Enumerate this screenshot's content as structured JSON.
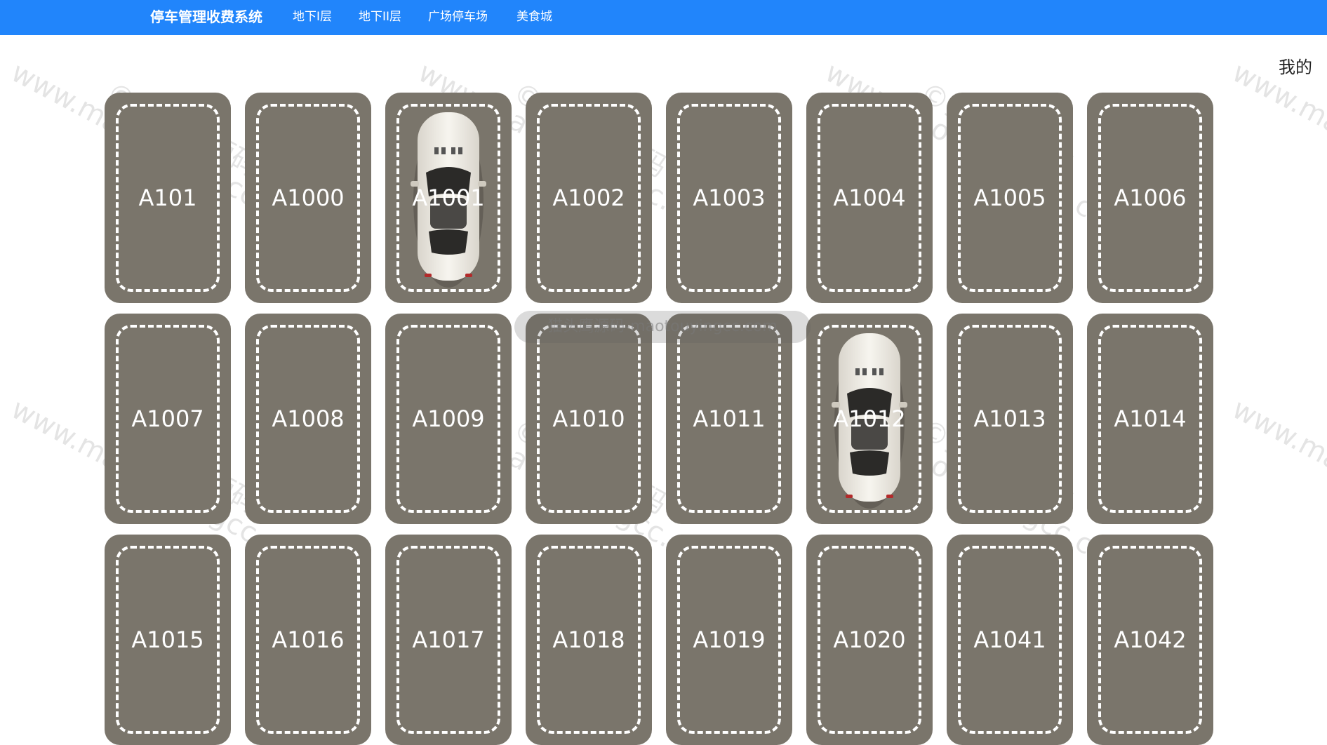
{
  "colors": {
    "nav_bg": "#2185fb",
    "slot_bg": "#7a756b",
    "lines": "#ffffff"
  },
  "nav": {
    "brand": "停车管理收费系统",
    "items": [
      {
        "label": "地下I层"
      },
      {
        "label": "地下II层"
      },
      {
        "label": "广场停车场"
      },
      {
        "label": "美食城"
      }
    ],
    "me": "我的"
  },
  "toast": "猫头鹰源码-maotouyingcc.com",
  "watermark": {
    "url": "www.maotouyingcc.com",
    "cn": "©猫头鹰源码"
  },
  "parking": {
    "slots": [
      {
        "id": "A101",
        "occupied": false
      },
      {
        "id": "A1000",
        "occupied": false
      },
      {
        "id": "A1001",
        "occupied": true
      },
      {
        "id": "A1002",
        "occupied": false
      },
      {
        "id": "A1003",
        "occupied": false
      },
      {
        "id": "A1004",
        "occupied": false
      },
      {
        "id": "A1005",
        "occupied": false
      },
      {
        "id": "A1006",
        "occupied": false
      },
      {
        "id": "A1007",
        "occupied": false
      },
      {
        "id": "A1008",
        "occupied": false
      },
      {
        "id": "A1009",
        "occupied": false
      },
      {
        "id": "A1010",
        "occupied": false
      },
      {
        "id": "A1011",
        "occupied": false
      },
      {
        "id": "A1012",
        "occupied": true
      },
      {
        "id": "A1013",
        "occupied": false
      },
      {
        "id": "A1014",
        "occupied": false
      },
      {
        "id": "A1015",
        "occupied": false
      },
      {
        "id": "A1016",
        "occupied": false
      },
      {
        "id": "A1017",
        "occupied": false
      },
      {
        "id": "A1018",
        "occupied": false
      },
      {
        "id": "A1019",
        "occupied": false
      },
      {
        "id": "A1020",
        "occupied": false
      },
      {
        "id": "A1041",
        "occupied": false
      },
      {
        "id": "A1042",
        "occupied": false
      }
    ]
  }
}
